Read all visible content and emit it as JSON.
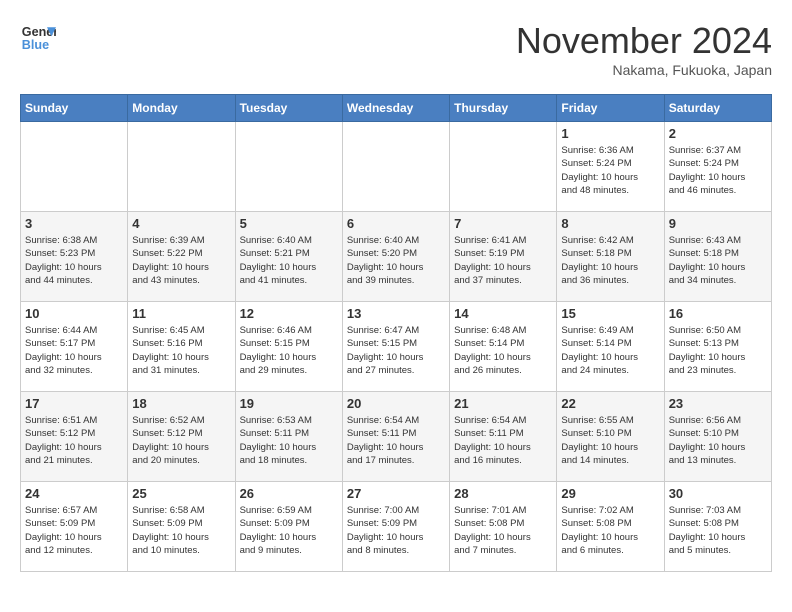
{
  "header": {
    "logo_line1": "General",
    "logo_line2": "Blue",
    "month": "November 2024",
    "location": "Nakama, Fukuoka, Japan"
  },
  "weekdays": [
    "Sunday",
    "Monday",
    "Tuesday",
    "Wednesday",
    "Thursday",
    "Friday",
    "Saturday"
  ],
  "weeks": [
    [
      {
        "day": "",
        "info": ""
      },
      {
        "day": "",
        "info": ""
      },
      {
        "day": "",
        "info": ""
      },
      {
        "day": "",
        "info": ""
      },
      {
        "day": "",
        "info": ""
      },
      {
        "day": "1",
        "info": "Sunrise: 6:36 AM\nSunset: 5:24 PM\nDaylight: 10 hours\nand 48 minutes."
      },
      {
        "day": "2",
        "info": "Sunrise: 6:37 AM\nSunset: 5:24 PM\nDaylight: 10 hours\nand 46 minutes."
      }
    ],
    [
      {
        "day": "3",
        "info": "Sunrise: 6:38 AM\nSunset: 5:23 PM\nDaylight: 10 hours\nand 44 minutes."
      },
      {
        "day": "4",
        "info": "Sunrise: 6:39 AM\nSunset: 5:22 PM\nDaylight: 10 hours\nand 43 minutes."
      },
      {
        "day": "5",
        "info": "Sunrise: 6:40 AM\nSunset: 5:21 PM\nDaylight: 10 hours\nand 41 minutes."
      },
      {
        "day": "6",
        "info": "Sunrise: 6:40 AM\nSunset: 5:20 PM\nDaylight: 10 hours\nand 39 minutes."
      },
      {
        "day": "7",
        "info": "Sunrise: 6:41 AM\nSunset: 5:19 PM\nDaylight: 10 hours\nand 37 minutes."
      },
      {
        "day": "8",
        "info": "Sunrise: 6:42 AM\nSunset: 5:18 PM\nDaylight: 10 hours\nand 36 minutes."
      },
      {
        "day": "9",
        "info": "Sunrise: 6:43 AM\nSunset: 5:18 PM\nDaylight: 10 hours\nand 34 minutes."
      }
    ],
    [
      {
        "day": "10",
        "info": "Sunrise: 6:44 AM\nSunset: 5:17 PM\nDaylight: 10 hours\nand 32 minutes."
      },
      {
        "day": "11",
        "info": "Sunrise: 6:45 AM\nSunset: 5:16 PM\nDaylight: 10 hours\nand 31 minutes."
      },
      {
        "day": "12",
        "info": "Sunrise: 6:46 AM\nSunset: 5:15 PM\nDaylight: 10 hours\nand 29 minutes."
      },
      {
        "day": "13",
        "info": "Sunrise: 6:47 AM\nSunset: 5:15 PM\nDaylight: 10 hours\nand 27 minutes."
      },
      {
        "day": "14",
        "info": "Sunrise: 6:48 AM\nSunset: 5:14 PM\nDaylight: 10 hours\nand 26 minutes."
      },
      {
        "day": "15",
        "info": "Sunrise: 6:49 AM\nSunset: 5:14 PM\nDaylight: 10 hours\nand 24 minutes."
      },
      {
        "day": "16",
        "info": "Sunrise: 6:50 AM\nSunset: 5:13 PM\nDaylight: 10 hours\nand 23 minutes."
      }
    ],
    [
      {
        "day": "17",
        "info": "Sunrise: 6:51 AM\nSunset: 5:12 PM\nDaylight: 10 hours\nand 21 minutes."
      },
      {
        "day": "18",
        "info": "Sunrise: 6:52 AM\nSunset: 5:12 PM\nDaylight: 10 hours\nand 20 minutes."
      },
      {
        "day": "19",
        "info": "Sunrise: 6:53 AM\nSunset: 5:11 PM\nDaylight: 10 hours\nand 18 minutes."
      },
      {
        "day": "20",
        "info": "Sunrise: 6:54 AM\nSunset: 5:11 PM\nDaylight: 10 hours\nand 17 minutes."
      },
      {
        "day": "21",
        "info": "Sunrise: 6:54 AM\nSunset: 5:11 PM\nDaylight: 10 hours\nand 16 minutes."
      },
      {
        "day": "22",
        "info": "Sunrise: 6:55 AM\nSunset: 5:10 PM\nDaylight: 10 hours\nand 14 minutes."
      },
      {
        "day": "23",
        "info": "Sunrise: 6:56 AM\nSunset: 5:10 PM\nDaylight: 10 hours\nand 13 minutes."
      }
    ],
    [
      {
        "day": "24",
        "info": "Sunrise: 6:57 AM\nSunset: 5:09 PM\nDaylight: 10 hours\nand 12 minutes."
      },
      {
        "day": "25",
        "info": "Sunrise: 6:58 AM\nSunset: 5:09 PM\nDaylight: 10 hours\nand 10 minutes."
      },
      {
        "day": "26",
        "info": "Sunrise: 6:59 AM\nSunset: 5:09 PM\nDaylight: 10 hours\nand 9 minutes."
      },
      {
        "day": "27",
        "info": "Sunrise: 7:00 AM\nSunset: 5:09 PM\nDaylight: 10 hours\nand 8 minutes."
      },
      {
        "day": "28",
        "info": "Sunrise: 7:01 AM\nSunset: 5:08 PM\nDaylight: 10 hours\nand 7 minutes."
      },
      {
        "day": "29",
        "info": "Sunrise: 7:02 AM\nSunset: 5:08 PM\nDaylight: 10 hours\nand 6 minutes."
      },
      {
        "day": "30",
        "info": "Sunrise: 7:03 AM\nSunset: 5:08 PM\nDaylight: 10 hours\nand 5 minutes."
      }
    ]
  ]
}
